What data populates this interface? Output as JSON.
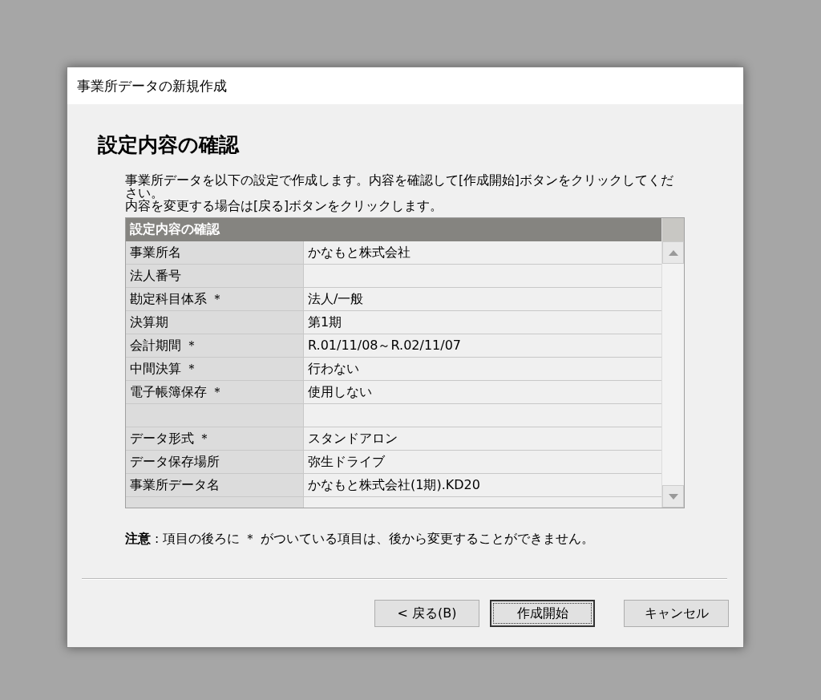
{
  "window": {
    "title": "事業所データの新規作成"
  },
  "heading": "設定内容の確認",
  "instructions": [
    "事業所データを以下の設定で作成します。内容を確認して[作成開始]ボタンをクリックしてください。",
    "内容を変更する場合は[戻る]ボタンをクリックします。"
  ],
  "table": {
    "title": "設定内容の確認",
    "rows": [
      {
        "kind": "item",
        "label": "事業所名",
        "value": "かなもと株式会社"
      },
      {
        "kind": "item",
        "label": "法人番号"
      },
      {
        "kind": "item",
        "label": "勘定科目体系 ＊",
        "value": "法人/一般"
      },
      {
        "kind": "item",
        "label": "決算期",
        "value": "第1期"
      },
      {
        "kind": "item",
        "label": "会計期間 ＊",
        "value": "R.01/11/08～R.02/11/07"
      },
      {
        "kind": "item",
        "label": "中間決算 ＊",
        "value": "行わない"
      },
      {
        "kind": "item",
        "label": "電子帳簿保存 ＊",
        "value": "使用しない"
      },
      {
        "kind": "blank"
      },
      {
        "kind": "item",
        "label": "データ形式 ＊",
        "value": "スタンドアロン"
      },
      {
        "kind": "item",
        "label": "データ保存場所",
        "value": "弥生ドライブ"
      },
      {
        "kind": "item",
        "label": "事業所データ名",
        "value": "かなもと株式会社(1期).KD20"
      },
      {
        "kind": "partial"
      }
    ]
  },
  "note": "**注意** : 項目の後ろに ＊ がついている項目は、後から変更することができません。",
  "buttons": [
    {
      "label": "< 戻る(B)",
      "default": false
    },
    {
      "label": "作成開始",
      "default": true
    },
    {
      "label": "キャンセル",
      "default": false
    }
  ]
}
